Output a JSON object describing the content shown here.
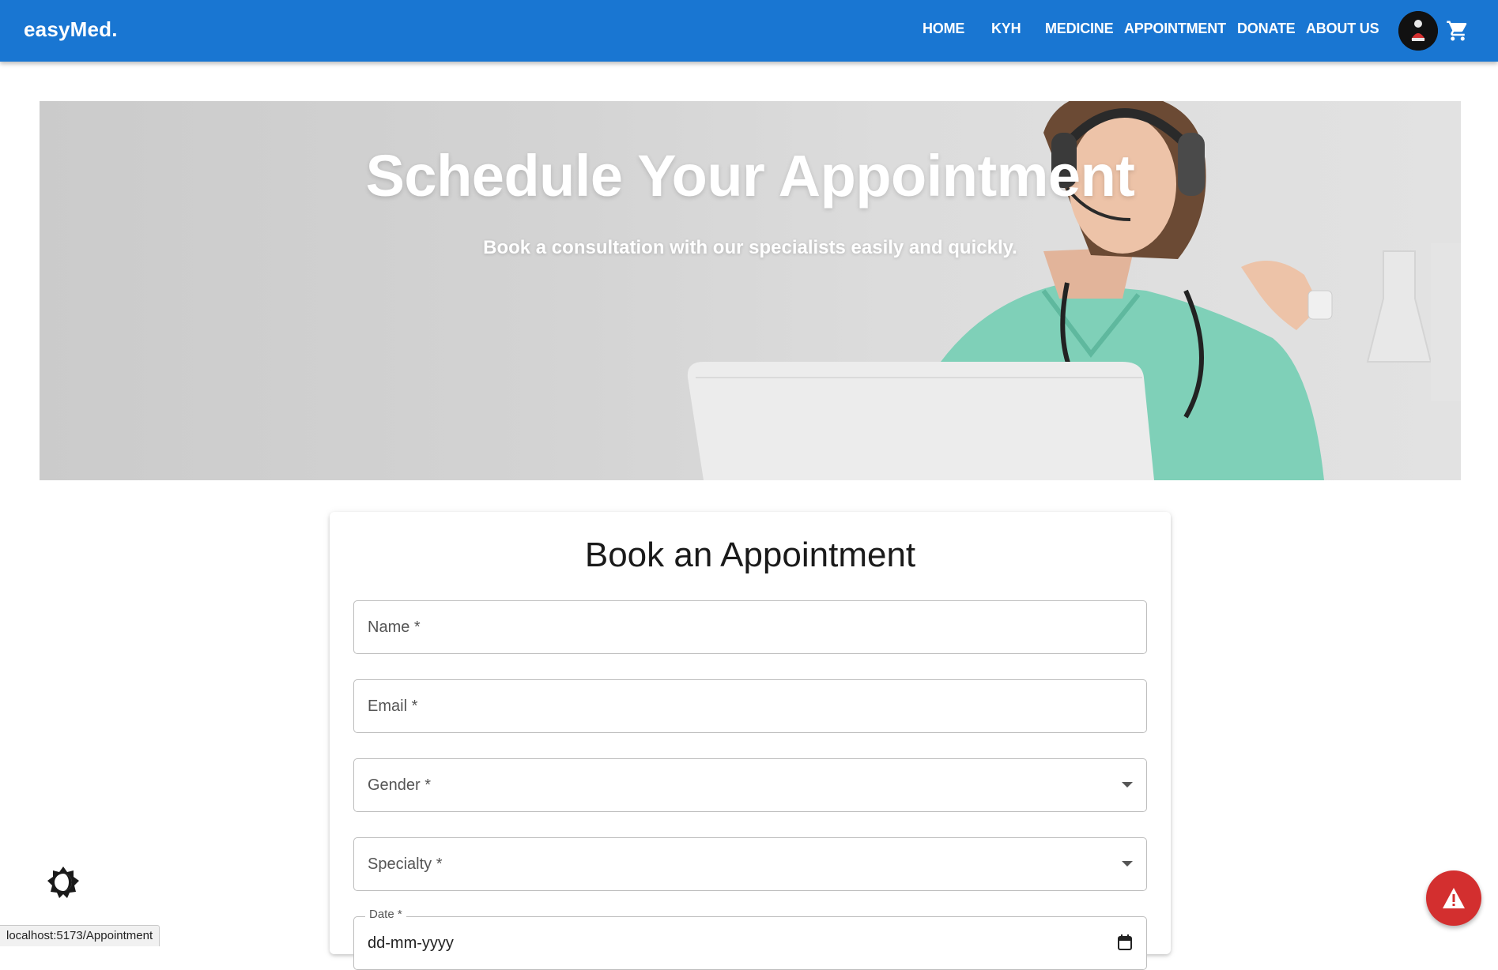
{
  "appbar": {
    "brand": "easyMed.",
    "nav": [
      {
        "label": "HOME",
        "name": "nav-home"
      },
      {
        "label": "KYH",
        "name": "nav-kyh"
      },
      {
        "label": "MEDICINE",
        "name": "nav-medicine"
      },
      {
        "label": "APPOINTMENT",
        "name": "nav-appointment"
      },
      {
        "label": "DONATE",
        "name": "nav-donate"
      },
      {
        "label": "ABOUT US",
        "name": "nav-about-us"
      }
    ],
    "icons": {
      "avatar": "user-avatar",
      "cart": "shopping-cart-icon"
    }
  },
  "hero": {
    "title": "Schedule Your Appointment",
    "subtitle": "Book a consultation with our specialists easily and quickly."
  },
  "form": {
    "title": "Book an Appointment",
    "fields": {
      "name": {
        "label": "Name *",
        "value": ""
      },
      "email": {
        "label": "Email *",
        "value": ""
      },
      "gender": {
        "label": "Gender *",
        "value": ""
      },
      "specialty": {
        "label": "Specialty *",
        "value": ""
      },
      "date": {
        "label": "Date *",
        "value": "dd-mm-yyyy"
      }
    }
  },
  "floating": {
    "theme_toggle_icon": "brightness-icon",
    "alert_icon": "warning-icon",
    "alert_color": "#d32f2f"
  },
  "status_bar": {
    "url": "localhost:5173/Appointment"
  },
  "colors": {
    "primary": "#1976d2",
    "card_bg": "#ffffff"
  }
}
